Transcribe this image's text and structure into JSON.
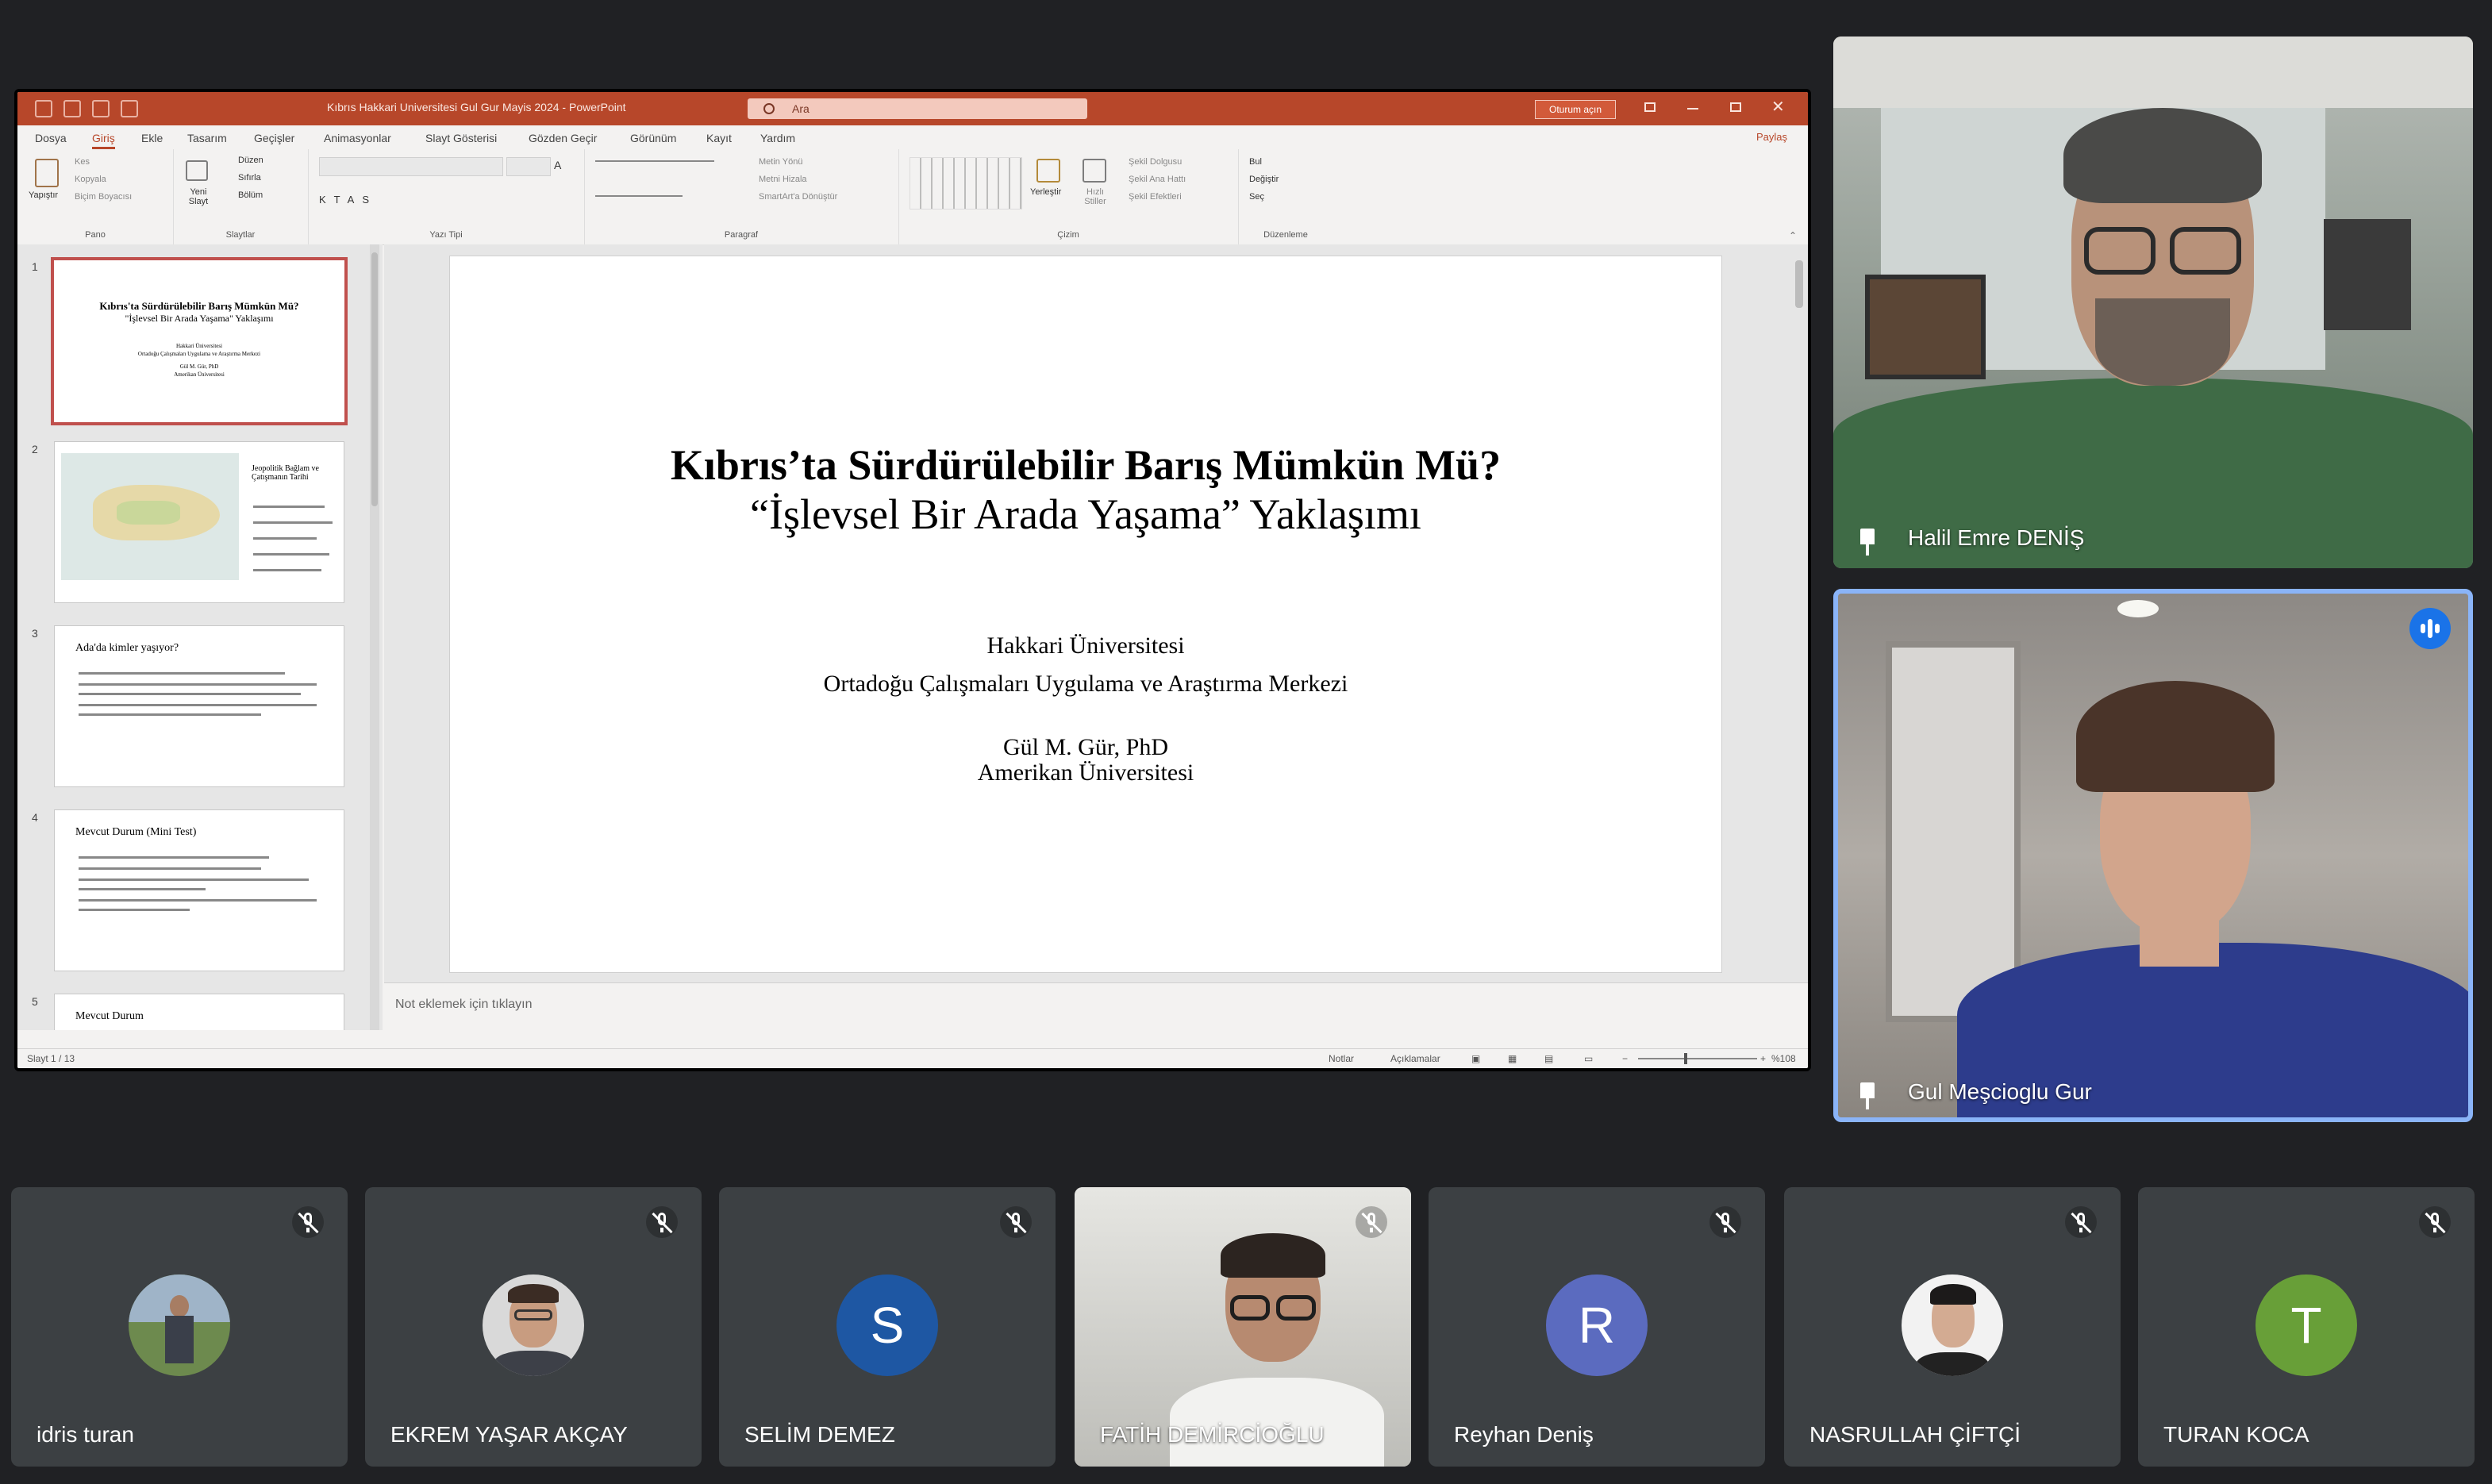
{
  "ppt": {
    "window_title": "Kıbrıs Hakkari Universitesi Gul Gur Mayis 2024  -  PowerPoint",
    "search_placeholder": "Ara",
    "signin": "Oturum açın",
    "share": "Paylaş",
    "menu": [
      "Dosya",
      "Giriş",
      "Ekle",
      "Tasarım",
      "Geçişler",
      "Animasyonlar",
      "Slayt Gösterisi",
      "Gözden Geçir",
      "Görünüm",
      "Kayıt",
      "Yardım"
    ],
    "ribbon": {
      "pano": {
        "paste": "Yapıştır",
        "cut": "Kes",
        "copy": "Kopyala",
        "format_painter": "Biçim Boyacısı",
        "label": "Pano"
      },
      "slaytlar": {
        "new_slide": "Yeni Slayt",
        "layout": "Düzen",
        "reset": "Sıfırla",
        "section": "Bölüm",
        "label": "Slaytlar"
      },
      "yazi_tipi": {
        "label": "Yazı Tipi"
      },
      "paragraf": {
        "text_direction": "Metin Yönü",
        "align_text": "Metni Hizala",
        "smartart": "SmartArt'a Dönüştür",
        "label": "Paragraf"
      },
      "cizim": {
        "arrange": "Yerleştir",
        "quick_styles": "Hızlı Stiller",
        "fill": "Şekil Dolgusu",
        "outline": "Şekil Ana Hattı",
        "effects": "Şekil Efektleri",
        "label": "Çizim"
      },
      "duzenleme": {
        "find": "Bul",
        "replace": "Değiştir",
        "select": "Seç",
        "label": "Düzenleme"
      }
    },
    "thumbnails": [
      {
        "num": "1",
        "title": "Kıbrıs'ta Sürdürülebilir Barış Mümkün Mü?",
        "subtitle": "\"İşlevsel Bir Arada Yaşama\" Yaklaşımı",
        "l1": "Hakkari Üniversitesi",
        "l2": "Ortadoğu Çalışmaları Uygulama ve Araştırma Merkezi",
        "l3": "Gül M. Gür, PhD",
        "l4": "Amerikan Üniversitesi"
      },
      {
        "num": "2",
        "title": "Jeopolitik Bağlam ve Çatışmanın Tarihi"
      },
      {
        "num": "3",
        "title": "Ada'da kimler yaşıyor?"
      },
      {
        "num": "4",
        "title": "Mevcut Durum (Mini Test)"
      },
      {
        "num": "5",
        "title": "Mevcut Durum"
      }
    ],
    "slide": {
      "title": "Kıbrıs’ta Sürdürülebilir Barış Mümkün Mü?",
      "subtitle": "“İşlevsel Bir Arada Yaşama” Yaklaşımı",
      "line1": "Hakkari Üniversitesi",
      "line2": "Ortadoğu Çalışmaları Uygulama ve Araştırma Merkezi",
      "line3": "Gül M. Gür, PhD",
      "line4": "Amerikan Üniversitesi"
    },
    "notes_placeholder": "Not eklemek için tıklayın",
    "status": {
      "slide_count": "Slayt 1 / 13",
      "notes": "Notlar",
      "comments": "Açıklamalar",
      "zoom": "%108"
    }
  },
  "meet": {
    "pinned": [
      {
        "name": "Halil Emre DENİŞ"
      },
      {
        "name": "Gul Meşcioglu Gur"
      }
    ],
    "participants": [
      {
        "name": "idris turan",
        "kind": "photo"
      },
      {
        "name": "EKREM YAŞAR AKÇAY",
        "kind": "photo"
      },
      {
        "name": "SELİM DEMEZ",
        "kind": "letter",
        "letter": "S",
        "color": "#1e57a3"
      },
      {
        "name": "FATİH DEMİRCİOĞLU",
        "kind": "video"
      },
      {
        "name": "Reyhan Deniş",
        "kind": "letter",
        "letter": "R",
        "color": "#5b6bbf"
      },
      {
        "name": "NASRULLAH ÇİFTÇİ",
        "kind": "photo"
      },
      {
        "name": "TURAN KOCA",
        "kind": "letter",
        "letter": "T",
        "color": "#689f38"
      }
    ],
    "accent": "#8ab4f8"
  }
}
